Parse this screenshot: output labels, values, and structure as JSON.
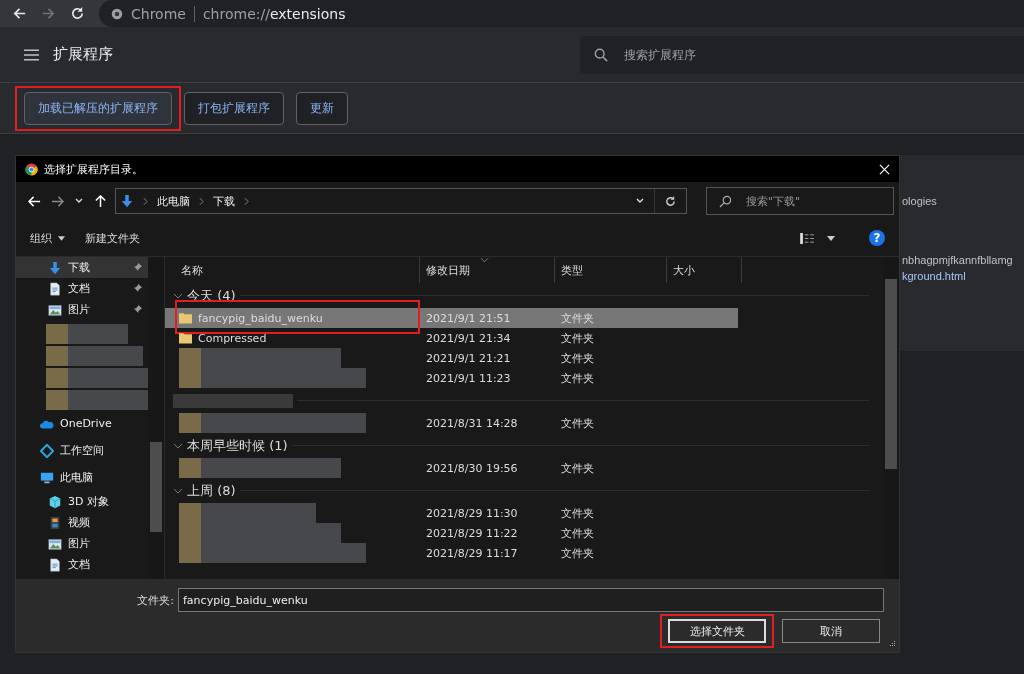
{
  "browser": {
    "brand": "Chrome",
    "url_prefix": "chrome://",
    "url_page": "extensions"
  },
  "header": {
    "title": "扩展程序",
    "search_placeholder": "搜索扩展程序"
  },
  "toolbar_buttons": [
    {
      "label": "加载已解压的扩展程序",
      "highlighted": true
    },
    {
      "label": "打包扩展程序",
      "highlighted": false
    },
    {
      "label": "更新",
      "highlighted": false
    }
  ],
  "background_card": {
    "lines": [
      {
        "text": "ologies",
        "kind": "text"
      },
      {
        "text": "nbhagpmjfkannfbllamg",
        "kind": "text"
      },
      {
        "text": "kground.html",
        "kind": "link"
      }
    ]
  },
  "dialog": {
    "title": "选择扩展程序目录。",
    "breadcrumbs": [
      "此电脑",
      "下载"
    ],
    "search_placeholder": "搜索\"下载\"",
    "commands": [
      {
        "label": "组织",
        "dropdown": true
      },
      {
        "label": "新建文件夹",
        "dropdown": false
      }
    ],
    "help_label": "?",
    "sidebar": {
      "pinned_items": [
        {
          "label": "下载",
          "kind": "download",
          "selected": true
        },
        {
          "label": "文档",
          "kind": "document",
          "selected": false
        },
        {
          "label": "图片",
          "kind": "picture",
          "selected": false
        }
      ],
      "locations": [
        {
          "label": "OneDrive",
          "kind": "cloud"
        },
        {
          "label": "工作空间",
          "kind": "diamond"
        },
        {
          "label": "此电脑",
          "kind": "computer",
          "children": [
            {
              "label": "3D 对象",
              "kind": "cube"
            },
            {
              "label": "视频",
              "kind": "video"
            },
            {
              "label": "图片",
              "kind": "picture"
            },
            {
              "label": "文档",
              "kind": "document"
            }
          ]
        }
      ]
    },
    "columns": [
      "名称",
      "修改日期",
      "类型",
      "大小"
    ],
    "groups": [
      {
        "label": "今天 (4)",
        "rows": [
          {
            "name": "fancypig_baidu_wenku",
            "date": "2021/9/1 21:51",
            "type": "文件夹",
            "selected": true,
            "highlighted": true
          },
          {
            "name": "Compressed",
            "date": "2021/9/1 21:34",
            "type": "文件夹",
            "selected": false,
            "highlighted": false
          },
          {
            "date": "2021/9/1 21:21",
            "type": "文件夹",
            "selected": false,
            "highlighted": false
          },
          {
            "date": "2021/9/1 11:23",
            "type": "文件夹",
            "selected": false,
            "highlighted": false
          }
        ]
      },
      {
        "rows": [
          {
            "date": "2021/8/31 14:28",
            "type": "文件夹",
            "selected": false,
            "highlighted": false
          }
        ]
      },
      {
        "label": "本周早些时候 (1)",
        "rows": [
          {
            "date": "2021/8/30 19:56",
            "type": "文件夹",
            "selected": false,
            "highlighted": false
          }
        ]
      },
      {
        "label": "上周 (8)",
        "rows": [
          {
            "date": "2021/8/29 11:30",
            "type": "文件夹",
            "selected": false,
            "highlighted": false
          },
          {
            "date": "2021/8/29 11:22",
            "type": "文件夹",
            "selected": false,
            "highlighted": false
          },
          {
            "date": "2021/8/29 11:17",
            "type": "文件夹",
            "selected": false,
            "highlighted": false
          }
        ]
      }
    ],
    "folder_label": "文件夹:",
    "folder_value": "fancypig_baidu_wenku",
    "buttons": [
      {
        "label": "选择文件夹",
        "kind": "primary",
        "highlighted": true
      },
      {
        "label": "取消",
        "kind": "secondary",
        "highlighted": false
      }
    ]
  }
}
